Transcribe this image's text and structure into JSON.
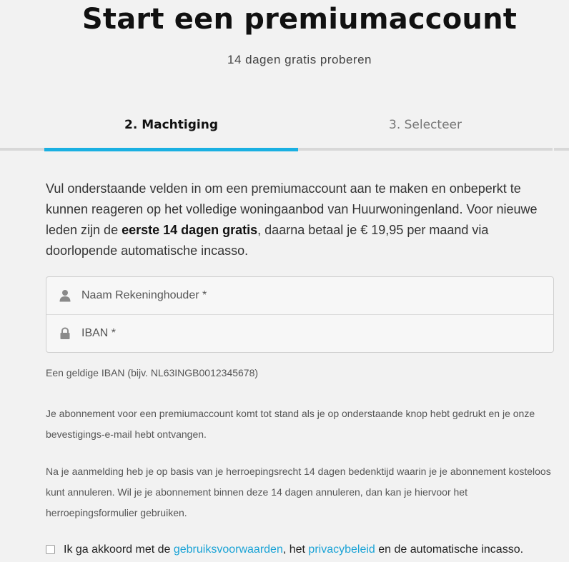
{
  "header": {
    "title": "Start een premiumaccount",
    "subtitle": "14 dagen gratis proberen"
  },
  "steps": [
    {
      "label": "2. Machtiging",
      "active": true
    },
    {
      "label": "3. Selecteer",
      "active": false
    }
  ],
  "intro": {
    "text_before": "Vul onderstaande velden in om een premiumaccount aan te maken en onbeperkt te kunnen reageren op het volledige woningaanbod van Huurwoningenland. Voor nieuwe leden zijn de ",
    "bold": "eerste 14 dagen gratis",
    "text_after": ", daarna betaal je € 19,95 per maand via doorlopende automatische incasso."
  },
  "form": {
    "name_field": {
      "placeholder": "Naam Rekeninghouder *",
      "value": "",
      "icon": "user-icon"
    },
    "iban_field": {
      "placeholder": "IBAN *",
      "value": "",
      "icon": "lock-icon"
    }
  },
  "hint": "Een geldige IBAN (bijv. NL63INGB0012345678)",
  "notes": [
    "Je abonnement voor een premiumaccount komt tot stand als je op onderstaande knop hebt gedrukt en je onze bevestigings-e-mail hebt ontvangen.",
    "Na je aanmelding heb je op basis van je herroepingsrecht 14 dagen bedenktijd waarin je je abonnement kosteloos kunt annuleren. Wil je je abonnement binnen deze 14 dagen annuleren, dan kan je hiervoor het herroepingsformulier gebruiken."
  ],
  "agreement": {
    "checked": false,
    "prefix": "Ik ga akkoord met de ",
    "terms_link": "gebruiksvoorwaarden",
    "middle": ", het ",
    "privacy_link": "privacybeleid",
    "suffix": " en de automatische incasso."
  },
  "colors": {
    "accent": "#1ab0e2",
    "link": "#1aa3d6",
    "background": "#f2f2f2"
  }
}
